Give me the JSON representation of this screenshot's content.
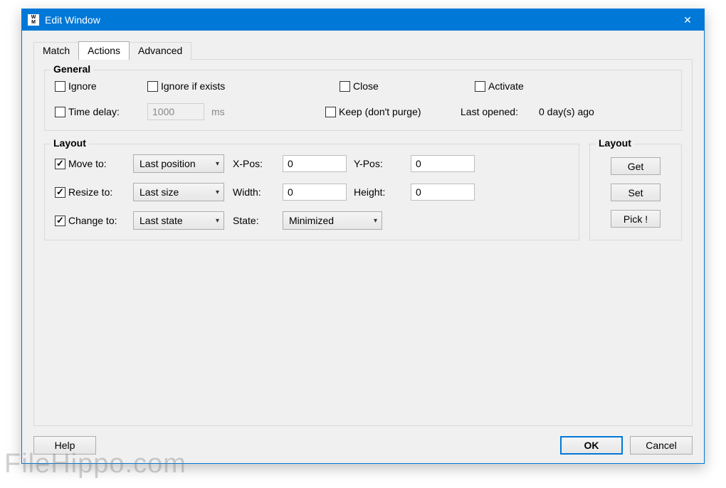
{
  "window": {
    "title": "Edit Window",
    "icon_text": "W\nM"
  },
  "tabs": {
    "match": "Match",
    "actions": "Actions",
    "advanced": "Advanced"
  },
  "general": {
    "legend": "General",
    "ignore": "Ignore",
    "ignore_if_exists": "Ignore if exists",
    "close": "Close",
    "activate": "Activate",
    "time_delay": "Time delay:",
    "time_delay_value": "1000",
    "time_delay_unit": "ms",
    "keep": "Keep (don't purge)",
    "last_opened_label": "Last opened:",
    "last_opened_value": "0 day(s) ago"
  },
  "layout": {
    "legend": "Layout",
    "move_to": "Move to:",
    "move_select": "Last position",
    "xpos_label": "X-Pos:",
    "xpos_value": "0",
    "ypos_label": "Y-Pos:",
    "ypos_value": "0",
    "resize_to": "Resize to:",
    "resize_select": "Last size",
    "width_label": "Width:",
    "width_value": "0",
    "height_label": "Height:",
    "height_value": "0",
    "change_to": "Change to:",
    "change_select": "Last state",
    "state_label": "State:",
    "state_select": "Minimized"
  },
  "layout_side": {
    "legend": "Layout",
    "get": "Get",
    "set": "Set",
    "pick": "Pick !"
  },
  "footer": {
    "help": "Help",
    "ok": "OK",
    "cancel": "Cancel"
  },
  "watermark": "FileHippo.com"
}
